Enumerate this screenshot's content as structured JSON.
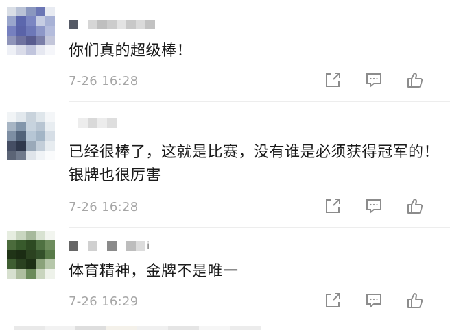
{
  "comments": [
    {
      "text": "你们真的超级棒！",
      "time": "7-26 16:28",
      "avatar_palette": [
        "#d9dee6",
        "#b9c2d6",
        "#8a97bf",
        "#6b76b5",
        "#e8ebf2",
        "#9aa6cc",
        "#5c67ad",
        "#7b86c2",
        "#c6cde3",
        "#a8b2d6",
        "#7680bf",
        "#5a63a8",
        "#6d78b8",
        "#8d97c8",
        "#b4bcdc",
        "#8f94b9",
        "#6f729f",
        "#595c8f",
        "#7a7ea8",
        "#c3c6da",
        "#eef0f6",
        "#dadce9",
        "#c1c5dd",
        "#e6e8f1",
        "#f5f6fa"
      ],
      "name_palette": [
        "#555a66",
        "#ffffff",
        "#d6d6d6",
        "#bfbfbf",
        "#cccccc",
        "#e3e3e3",
        "#c8c8c8",
        "#dadada",
        "#c2c2c2"
      ],
      "name_trail": ""
    },
    {
      "text": "已经很棒了，这就是比赛，没有谁是必须获得冠军的！银牌也很厉害",
      "time": "7-26 16:28",
      "avatar_palette": [
        "#f1f4f6",
        "#e2e8ed",
        "#c9d3dc",
        "#dfe6eb",
        "#f4f6f8",
        "#a7b5c4",
        "#8396ab",
        "#c7d3de",
        "#b8c5d2",
        "#e8edf1",
        "#7d8ea3",
        "#52637a",
        "#b6c6d5",
        "#a3b5c6",
        "#d6dee6",
        "#454e64",
        "#2f384c",
        "#9aa9b9",
        "#c3ced9",
        "#e7ecf0",
        "#5b6476",
        "#707a8c",
        "#dfe4ea",
        "#f0f3f6",
        "#fafbfc"
      ],
      "name_palette": [
        "#ffffff",
        "#ededed",
        "#d9d9d9",
        "#ececec",
        "#dedede",
        "#ffffff"
      ],
      "name_trail": ""
    },
    {
      "text": "体育精神，金牌不是唯一",
      "time": "7-26 16:29",
      "avatar_palette": [
        "#e6ede0",
        "#c9d6c0",
        "#a7b99c",
        "#d8e2d1",
        "#f2f5ef",
        "#4b6b3c",
        "#385a2c",
        "#2d4a22",
        "#4f7142",
        "#6e8d5e",
        "#203417",
        "#1b2c13",
        "#2b4220",
        "#33502a",
        "#587a49",
        "#3f5e32",
        "#2a4120",
        "#1d3015",
        "#8aa27a",
        "#b6c7aa",
        "#d7e0cf",
        "#aebe9f",
        "#6b8a5a",
        "#c9d5be",
        "#eef2ea"
      ],
      "name_palette": [
        "#666666",
        "#ffffff",
        "#d0d0d0",
        "#ffffff",
        "#8a8a8a",
        "#ffffff",
        "#bdbdbd",
        "#dcdcdc"
      ],
      "name_trail": "i"
    }
  ],
  "icons": {
    "share": "share-icon",
    "comment": "comment-icon",
    "like": "like-icon"
  },
  "colors": {
    "icon": "#8c8c8c",
    "time": "#a6a6a6",
    "text": "#1a1a1a",
    "divider": "#ededed"
  },
  "bottom_strip_palette": [
    "#e9e9e9",
    "#f2f2f2",
    "#dedede",
    "#f4f1ea",
    "#f0f0f0",
    "#e5e5e5",
    "#f6f6f6",
    "#ececec"
  ]
}
